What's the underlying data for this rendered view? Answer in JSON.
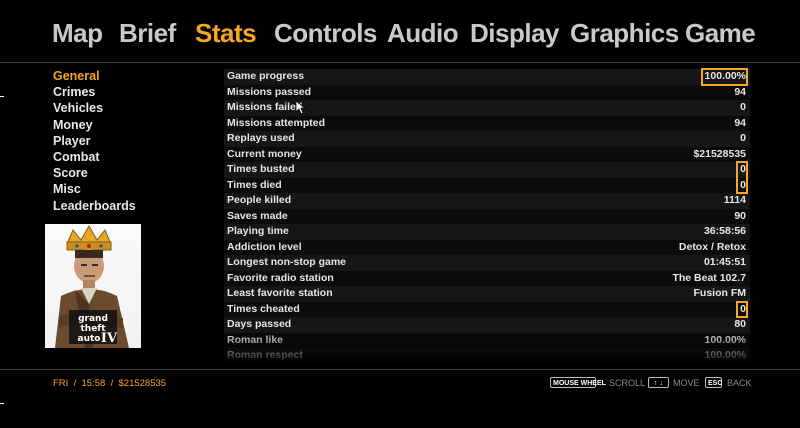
{
  "nav": {
    "tabs": [
      {
        "label": "Map"
      },
      {
        "label": "Brief"
      },
      {
        "label": "Stats",
        "active": true
      },
      {
        "label": "Controls"
      },
      {
        "label": "Audio"
      },
      {
        "label": "Display"
      },
      {
        "label": "Graphics"
      },
      {
        "label": "Game"
      }
    ]
  },
  "sidebar": {
    "items": [
      {
        "label": "General",
        "active": true
      },
      {
        "label": "Crimes"
      },
      {
        "label": "Vehicles"
      },
      {
        "label": "Money"
      },
      {
        "label": "Player"
      },
      {
        "label": "Combat"
      },
      {
        "label": "Score"
      },
      {
        "label": "Misc"
      },
      {
        "label": "Leaderboards"
      }
    ]
  },
  "cover": {
    "logo_text": "grand theft auto IV"
  },
  "stats": {
    "rows": [
      {
        "label": "Game progress",
        "value": "100.00%"
      },
      {
        "label": "Missions passed",
        "value": "94"
      },
      {
        "label": "Missions failed",
        "value": "0"
      },
      {
        "label": "Missions attempted",
        "value": "94"
      },
      {
        "label": "Replays used",
        "value": "0"
      },
      {
        "label": "Current money",
        "value": "$21528535"
      },
      {
        "label": "Times busted",
        "value": "0"
      },
      {
        "label": "Times died",
        "value": "0"
      },
      {
        "label": "People killed",
        "value": "1114"
      },
      {
        "label": "Saves made",
        "value": "90"
      },
      {
        "label": "Playing time",
        "value": "36:58:56"
      },
      {
        "label": "Addiction level",
        "value": "Detox / Retox"
      },
      {
        "label": "Longest non-stop game",
        "value": "01:45:51"
      },
      {
        "label": "Favorite radio station",
        "value": "The Beat 102.7"
      },
      {
        "label": "Least favorite station",
        "value": "Fusion FM"
      },
      {
        "label": "Times cheated",
        "value": "0"
      },
      {
        "label": "Days passed",
        "value": "80"
      },
      {
        "label": "Roman like",
        "value": "100.00%"
      },
      {
        "label": "Roman respect",
        "value": "100.00%"
      }
    ]
  },
  "footer": {
    "day": "FRI",
    "sep1": "/",
    "time": "15:58",
    "sep2": "/",
    "money": "$21528535",
    "mousewheel_key": "MOUSE WHEEL",
    "scroll_label": "SCROLL",
    "arrows_key": "↑ ↓",
    "move_label": "MOVE",
    "esc_key": "ESC",
    "back_label": "BACK"
  },
  "colors": {
    "accent": "#f5a623",
    "background": "#000000",
    "row_light": "#161616",
    "row_dark": "#0b0b0b"
  }
}
